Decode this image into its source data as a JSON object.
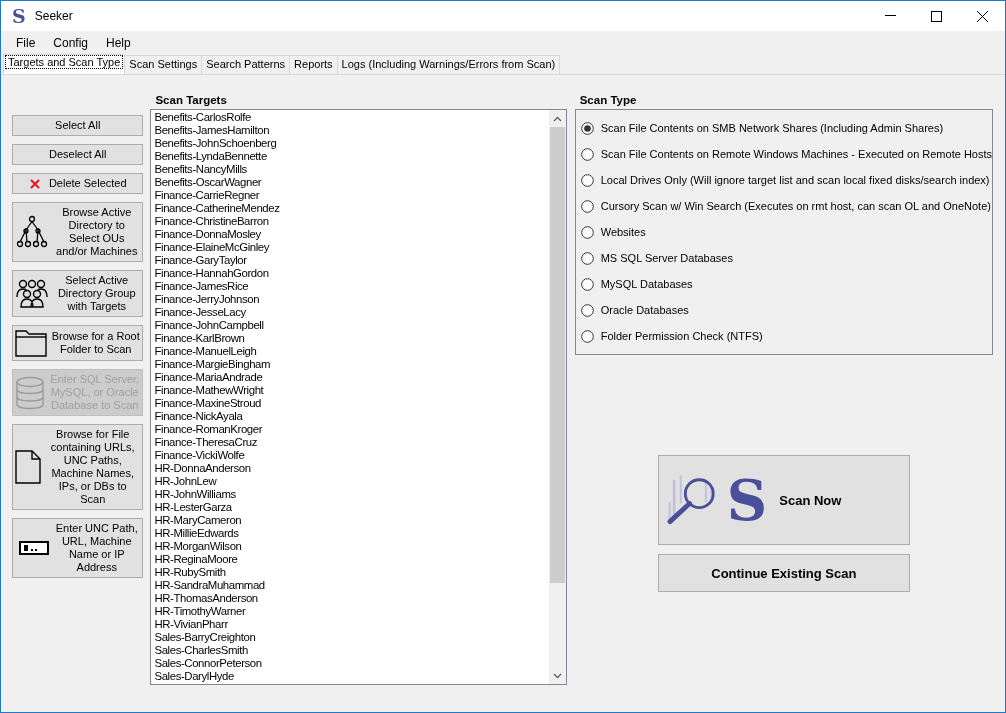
{
  "window": {
    "logo": "S",
    "title": "Seeker"
  },
  "menu": [
    "File",
    "Config",
    "Help"
  ],
  "tabs": [
    {
      "label": "Targets and Scan Type",
      "selected": true
    },
    {
      "label": "Scan Settings",
      "selected": false
    },
    {
      "label": "Search Patterns",
      "selected": false
    },
    {
      "label": "Reports",
      "selected": false
    },
    {
      "label": "Logs (Including Warnings/Errors from Scan)",
      "selected": false
    }
  ],
  "actions": [
    {
      "kind": "plain",
      "label": "Select All",
      "disabled": false
    },
    {
      "kind": "plain",
      "label": "Deselect All",
      "disabled": false
    },
    {
      "kind": "delete",
      "label": "Delete Selected",
      "disabled": false
    },
    {
      "kind": "tree",
      "label": "Browse Active Directory to Select OUs and/or Machines",
      "disabled": false
    },
    {
      "kind": "group",
      "label": "Select Active Directory Group with Targets",
      "disabled": false
    },
    {
      "kind": "folder",
      "label": "Browse for a Root Folder to Scan",
      "disabled": false
    },
    {
      "kind": "database",
      "label": "Enter SQL Server, MySQL, or Oracle Database to Scan",
      "disabled": true
    },
    {
      "kind": "file",
      "label": "Browse for File containing URLs, UNC Paths, Machine Names, IPs, or DBs to Scan",
      "disabled": false
    },
    {
      "kind": "textbox",
      "label": "Enter UNC Path, URL, Machine Name or IP Address",
      "disabled": false
    }
  ],
  "scan_targets": {
    "title": "Scan Targets",
    "items": [
      "Benefits-CarlosRolfe",
      "Benefits-JamesHamilton",
      "Benefits-JohnSchoenberg",
      "Benefits-LyndaBennette",
      "Benefits-NancyMills",
      "Benefits-OscarWagner",
      "Finance-CarrieRegner",
      "Finance-CatherineMendez",
      "Finance-ChristineBarron",
      "Finance-DonnaMosley",
      "Finance-ElaineMcGinley",
      "Finance-GaryTaylor",
      "Finance-HannahGordon",
      "Finance-JamesRice",
      "Finance-JerryJohnson",
      "Finance-JesseLacy",
      "Finance-JohnCampbell",
      "Finance-KarlBrown",
      "Finance-ManuelLeigh",
      "Finance-MargieBingham",
      "Finance-MariaAndrade",
      "Finance-MathewWright",
      "Finance-MaxineStroud",
      "Finance-NickAyala",
      "Finance-RomanKroger",
      "Finance-TheresaCruz",
      "Finance-VickiWolfe",
      "HR-DonnaAnderson",
      "HR-JohnLew",
      "HR-JohnWilliams",
      "HR-LesterGarza",
      "HR-MaryCameron",
      "HR-MillieEdwards",
      "HR-MorganWilson",
      "HR-ReginaMoore",
      "HR-RubySmith",
      "HR-SandraMuhammad",
      "HR-ThomasAnderson",
      "HR-TimothyWarner",
      "HR-VivianPharr",
      "Sales-BarryCreighton",
      "Sales-CharlesSmith",
      "Sales-ConnorPeterson",
      "Sales-DarylHyde"
    ]
  },
  "scan_type": {
    "title": "Scan Type",
    "options": [
      {
        "label": "Scan File Contents on SMB Network Shares (Including Admin Shares)",
        "selected": true
      },
      {
        "label": "Scan File Contents on Remote Windows Machines - Executed on Remote Hosts",
        "selected": false
      },
      {
        "label": "Local Drives Only (Will ignore target list and scan local fixed disks/search index)",
        "selected": false
      },
      {
        "label": "Cursory Scan w/ Win Search (Executes on rmt host, can scan OL and OneNote)",
        "selected": false
      },
      {
        "label": "Websites",
        "selected": false
      },
      {
        "label": "MS SQL Server Databases",
        "selected": false
      },
      {
        "label": "MySQL Databases",
        "selected": false
      },
      {
        "label": "Oracle Databases",
        "selected": false
      },
      {
        "label": "Folder Permission Check (NTFS)",
        "selected": false
      }
    ]
  },
  "scan_now": {
    "logo": "S",
    "label": "Scan Now"
  },
  "continue_button": "Continue Existing Scan"
}
